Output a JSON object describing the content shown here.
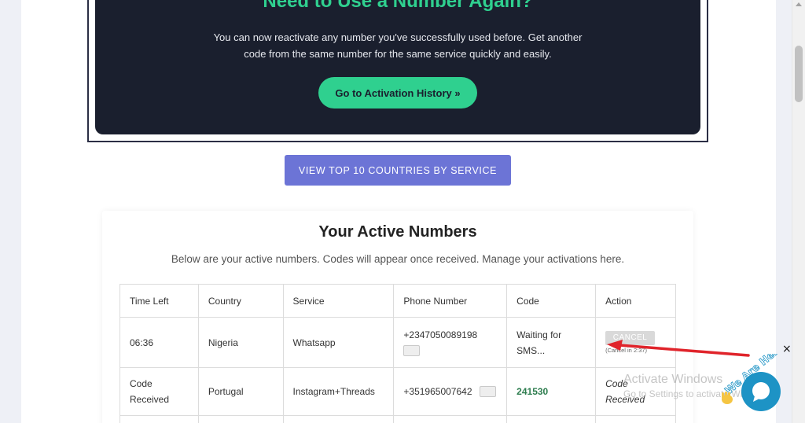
{
  "promo": {
    "title": "Need to Use a Number Again?",
    "text": "You can now reactivate any number you've successfully used before. Get another code from the same number for the same service quickly and easily.",
    "button": "Go to Activation History »"
  },
  "view_top_button": "VIEW TOP 10 COUNTRIES BY SERVICE",
  "active": {
    "title": "Your Active Numbers",
    "subtitle": "Below are your active numbers. Codes will appear once received. Manage your activations here.",
    "headers": [
      "Time Left",
      "Country",
      "Service",
      "Phone Number",
      "Code",
      "Action"
    ],
    "rows": [
      {
        "time_left": "06:36",
        "country": "Nigeria",
        "service": "Whatsapp",
        "phone": "+2347050089198",
        "code": "Waiting for SMS...",
        "action": "CANCEL",
        "action_note": "(Cancel in 2:37)"
      },
      {
        "time_left": "Code Received",
        "country": "Portugal",
        "service": "Instagram+Threads",
        "phone": "+351965007642",
        "code": "241530",
        "action": "Code Received"
      }
    ]
  },
  "overlay": {
    "watermark_line1": "Activate Windows",
    "watermark_line2": "Go to Settings to activate Windows.",
    "chat_badge": "We Are Here!",
    "close": "×"
  },
  "colors": {
    "accent_green": "#2fd08f",
    "promo_bg": "#1a1f2e",
    "button_blue": "#6c74d6",
    "arrow_red": "#e0242b",
    "chat_blue": "#1d93c5"
  }
}
